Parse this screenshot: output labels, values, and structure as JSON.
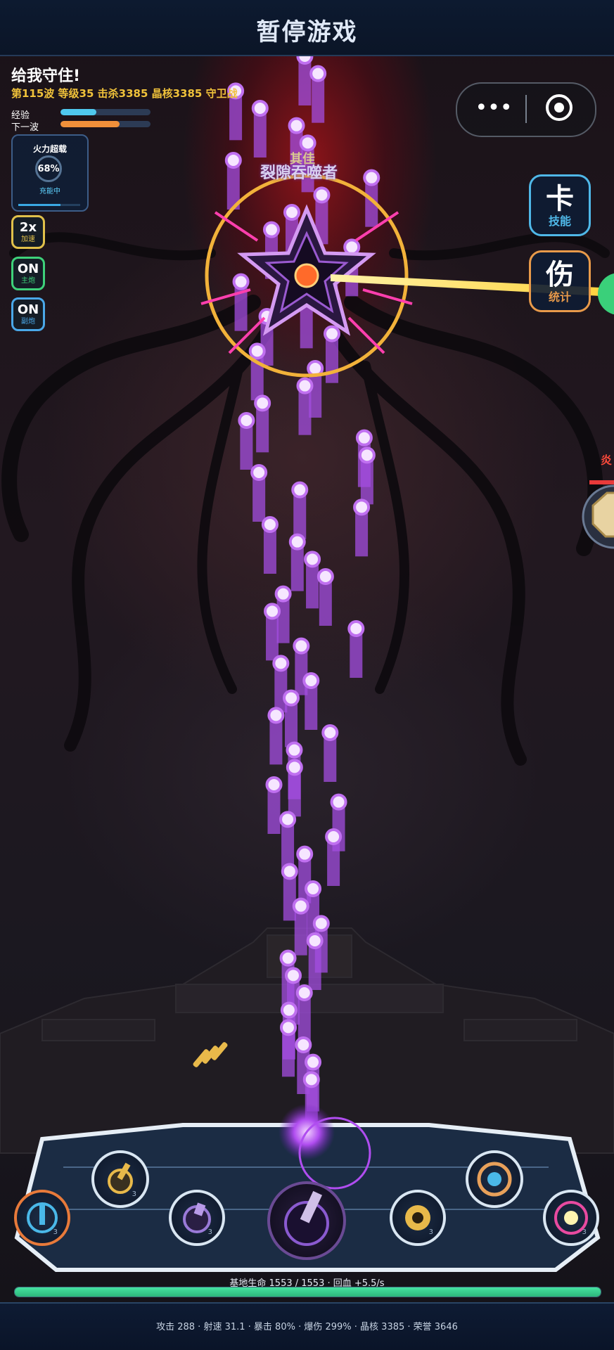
{
  "header": {
    "title": "暂停游戏"
  },
  "hud": {
    "title": "给我守住!",
    "stats": "第115波 等级35 击杀3385 晶核3385 守卫战",
    "exp_label": "经验",
    "exp_progress": 0.4,
    "next_wave_label": "下一波",
    "next_wave_progress": 0.66
  },
  "fire_card": {
    "title": "火力超载",
    "percent": "68%",
    "percent_value": 0.68,
    "status": "充能中"
  },
  "side_buttons": [
    {
      "value": "2x",
      "label": "加速",
      "color": "#e0c04a"
    },
    {
      "value": "ON",
      "label": "主炮",
      "color": "#3ed17a"
    },
    {
      "value": "ON",
      "label": "副炮",
      "color": "#4aa8e8"
    }
  ],
  "menu_capsule": {
    "more_icon": "more-dots-icon",
    "close_icon": "target-close-icon"
  },
  "right_buttons": [
    {
      "glyph": "卡",
      "label": "技能",
      "color": "#4fb8e8"
    },
    {
      "glyph": "伤",
      "label": "统计",
      "color": "#e89a4a"
    }
  ],
  "boss": {
    "name": "裂隙吞噬者",
    "title": "其佳"
  },
  "side_enemy": {
    "label": "炎",
    "hp_fraction": 1.0
  },
  "turrets": [
    {
      "name": "plasma-turret",
      "icon": "rune-icon",
      "level": "3"
    },
    {
      "name": "cannon-turret",
      "icon": "cannon-icon",
      "level": "3"
    },
    {
      "name": "void-turret",
      "icon": "void-icon",
      "level": "3"
    },
    {
      "name": "main-turret",
      "icon": "main-cannon-icon",
      "level": ""
    },
    {
      "name": "gear-turret",
      "icon": "gear-icon",
      "level": "3"
    },
    {
      "name": "orb-turret",
      "icon": "orb-icon",
      "level": ""
    },
    {
      "name": "prism-turret",
      "icon": "prism-icon",
      "level": "3"
    }
  ],
  "base": {
    "hp_text": "基地生命 1553 / 1553 · 回血 +5.5/s",
    "hp_fraction": 1.0
  },
  "footer": {
    "stats": "攻击 288 · 射速 31.1 · 暴击 80% · 爆伤 299% · 晶核 3385 · 荣誉 3646"
  }
}
